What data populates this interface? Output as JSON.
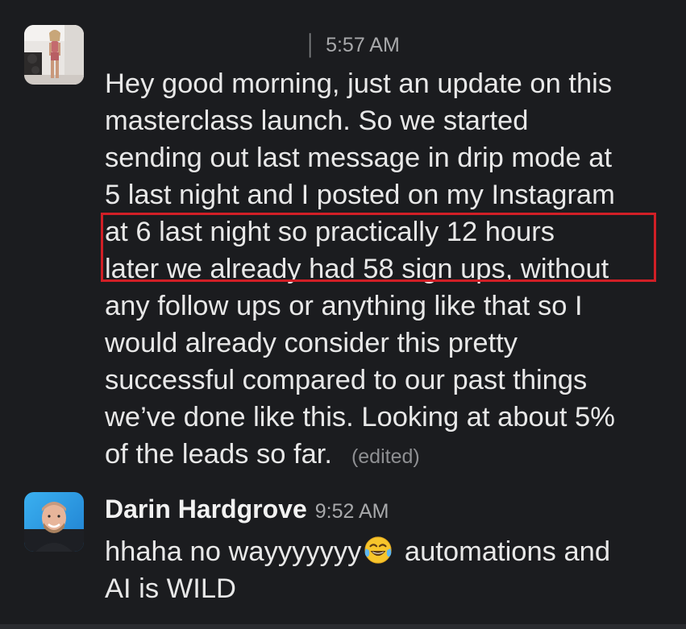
{
  "messages": [
    {
      "sender": "",
      "time": "5:57 AM",
      "time_prefix": "│",
      "avatar": "woman-avatar-photo",
      "lines": [
        "Hey good morning, just an update on this",
        "masterclass launch. So we started",
        "sending out last message in drip mode at",
        "5 last night and I posted on my Instagram",
        "at 6 last night so practically 12 hours",
        "later we already had 58 sign ups, without",
        "any follow ups or anything like that so I",
        "would already consider this pretty",
        "successful compared to our past things",
        "we’ve done like this. Looking at about 5%",
        "of the leads so far."
      ],
      "edited_label": "(edited)"
    },
    {
      "sender": "Darin Hardgrove",
      "time": "9:52 AM",
      "avatar": "man-avatar-photo",
      "line1_before_emoji": "hhaha no wayyyyyyy",
      "emoji": "face-with-tears-of-joy-emoji",
      "line1_after_emoji": " automations and",
      "line2": "AI is WILD"
    }
  ],
  "colors": {
    "background": "#1b1c1f",
    "text": "#e8e8e8",
    "timestamp": "#a8a9ab",
    "highlight_box": "#d11f26"
  }
}
